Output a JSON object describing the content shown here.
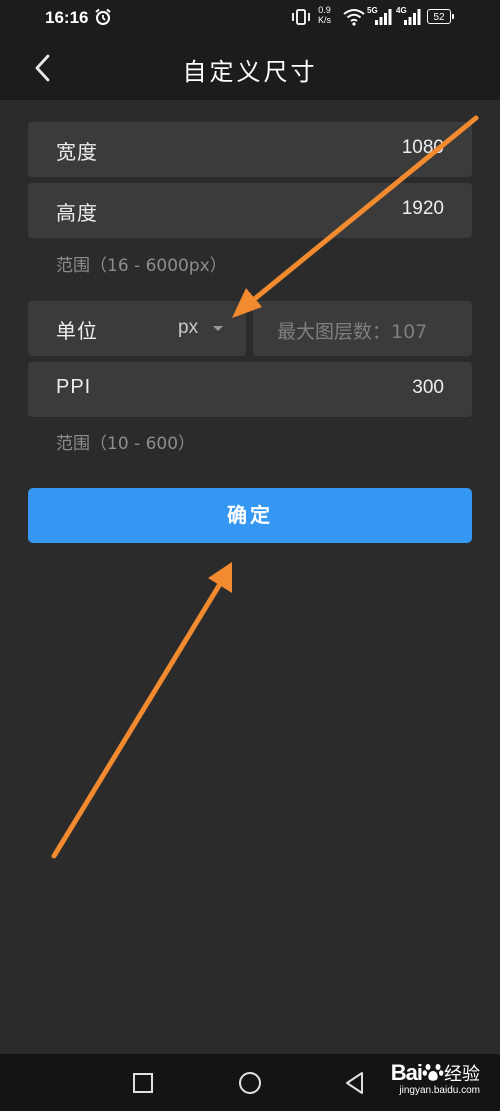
{
  "status_bar": {
    "time": "16:16",
    "net_speed_value": "0.9",
    "net_speed_unit": "K/s",
    "signal_1_label": "5G",
    "signal_2_label": "4G",
    "battery": "52",
    "icons": [
      "alarm-icon",
      "vibrate-icon",
      "wifi-icon",
      "signal-5g-icon",
      "signal-4g-icon",
      "battery-icon"
    ]
  },
  "header": {
    "title": "自定义尺寸",
    "back_icon": "chevron-left-icon"
  },
  "form": {
    "width": {
      "label": "宽度",
      "value": "1080"
    },
    "height": {
      "label": "高度",
      "value": "1920"
    },
    "size_range": "范围（16 - 6000px）",
    "unit": {
      "label": "单位",
      "value": "px"
    },
    "max_layers": "最大图层数：107",
    "ppi": {
      "label": "PPI",
      "value": "300"
    },
    "ppi_range": "范围（10 - 600）"
  },
  "confirm_label": "确定",
  "colors": {
    "background": "#2b2b2b",
    "field": "#3b3b3b",
    "accent": "#3597f2",
    "annotation": "#f28a30"
  },
  "nav": {
    "icons": [
      "recent-apps-icon",
      "home-icon",
      "back-triangle-icon"
    ]
  },
  "watermark": {
    "logo_left": "Bai",
    "logo_right": "经验",
    "url": "jingyan.baidu.com"
  }
}
